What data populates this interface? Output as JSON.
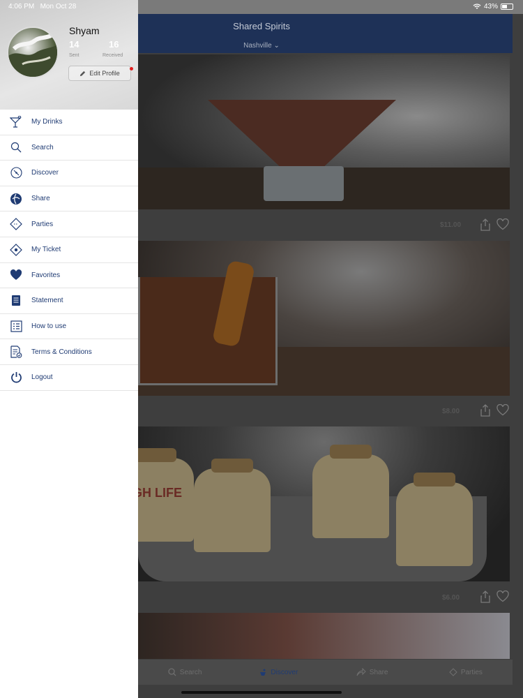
{
  "status": {
    "time": "4:06 PM",
    "date": "Mon Oct 28",
    "battery": "43%"
  },
  "app": {
    "title": "Shared Spirits",
    "city": "Nashville",
    "items": [
      {
        "price": "$11.00"
      },
      {
        "price": "$8.00"
      },
      {
        "price": "$6.00"
      }
    ],
    "bottle_label": "IGH LIFE",
    "tabs": [
      {
        "label": "Search",
        "icon": "search-icon"
      },
      {
        "label": "Discover",
        "icon": "discover-icon"
      },
      {
        "label": "Share",
        "icon": "share-icon"
      },
      {
        "label": "Parties",
        "icon": "ticket-icon"
      }
    ]
  },
  "profile": {
    "name": "Shyam",
    "sent_count": "14",
    "sent_label": "Sent",
    "received_count": "16",
    "received_label": "Received",
    "edit_label": "Edit Profile"
  },
  "menu": [
    {
      "label": "My Drinks",
      "icon": "cocktail-icon"
    },
    {
      "label": "Search",
      "icon": "search-icon"
    },
    {
      "label": "Discover",
      "icon": "compass-icon"
    },
    {
      "label": "Share",
      "icon": "share-globe-icon"
    },
    {
      "label": "Parties",
      "icon": "ticket-icon"
    },
    {
      "label": "My Ticket",
      "icon": "my-ticket-icon"
    },
    {
      "label": "Favorites",
      "icon": "heart-icon"
    },
    {
      "label": "Statement",
      "icon": "statement-icon"
    },
    {
      "label": "How to use",
      "icon": "guide-icon"
    },
    {
      "label": "Terms & Conditions",
      "icon": "terms-icon"
    },
    {
      "label": "Logout",
      "icon": "power-icon"
    }
  ],
  "colors": {
    "navy": "#1f3b73",
    "header": "#1e3157",
    "notification_dot": "#e21d1d"
  }
}
